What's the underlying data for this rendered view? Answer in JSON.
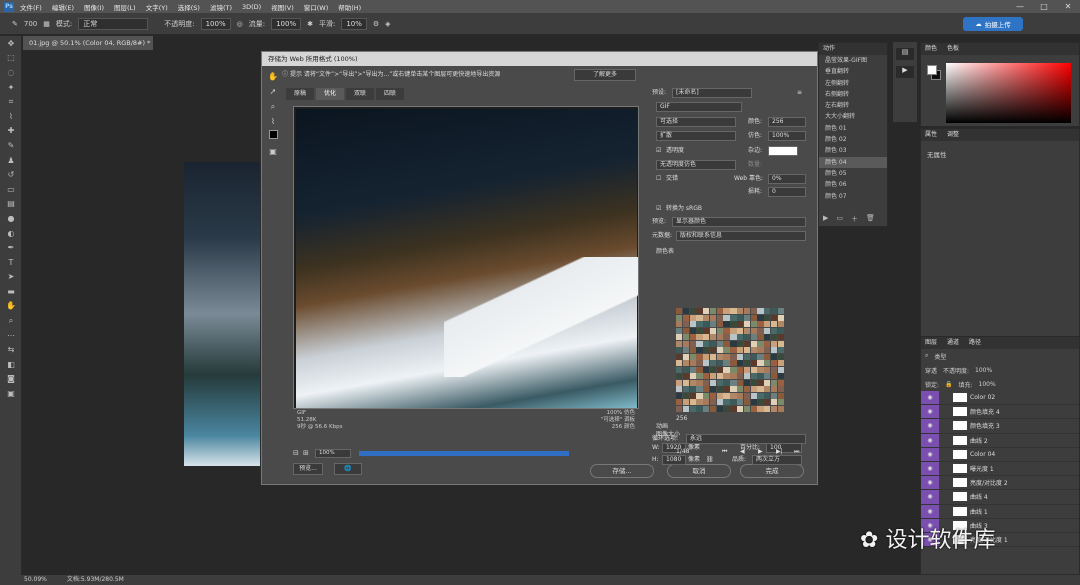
{
  "menubar": {
    "logo": "Ps",
    "items": [
      "文件(F)",
      "编辑(E)",
      "图像(I)",
      "图层(L)",
      "文字(Y)",
      "选择(S)",
      "滤镜(T)",
      "3D(D)",
      "视图(V)",
      "窗口(W)",
      "帮助(H)"
    ],
    "window_controls": [
      "—",
      "□",
      "✕"
    ]
  },
  "optbar": {
    "mode_label": "模式:",
    "mode_value": "正常",
    "opacity_label": "不透明度:",
    "opacity_value": "100%",
    "flow_label": "流量:",
    "flow_value": "100%",
    "smooth_label": "平滑:",
    "smooth_value": "10%",
    "brush_size": "700",
    "share_label": "拍摄上传"
  },
  "doc": {
    "tab": "01.jpg @ 50.1% (Color 04, RGB/8#) *",
    "status_zoom": "50.09%",
    "status_doc": "文档:5.93M/280.5M"
  },
  "dialog": {
    "title": "存储为 Web 所用格式 (100%)",
    "hint_prefix": "提示",
    "hint": "请将“文件”>“导出”>“导出为...”或右键单击某个图层可更快速地导出资源",
    "learn_more": "了解更多",
    "tabs": [
      "原稿",
      "优化",
      "双联",
      "四联"
    ],
    "preview_info_left": [
      "GIF",
      "51.28K",
      "9秒 @ 56.6 Kbps"
    ],
    "preview_info_right": [
      "100% 仿色",
      "\"可选择\" 调板",
      "256 颜色"
    ],
    "zoom": "100%",
    "preview_button": "预览...",
    "save": "存储...",
    "cancel": "取消",
    "done": "完成"
  },
  "settings": {
    "preset_label": "预设:",
    "preset_value": "[未命名]",
    "format": "GIF",
    "reduction": "可选择",
    "dither_algo": "扩散",
    "colors_label": "颜色:",
    "colors_value": "256",
    "dither_label": "仿色:",
    "dither_value": "100%",
    "transparency": "透明度",
    "matte_label": "杂边:",
    "no_transparency_dither": "无透明度仿色",
    "amount_label": "数量:",
    "interlaced": "交错",
    "web_snap_label": "Web 靠色:",
    "web_snap_value": "0%",
    "lossy_label": "损耗:",
    "lossy_value": "0",
    "convert_srgb": "转换为 sRGB",
    "preview_label": "预览:",
    "preview_value": "显示器颜色",
    "metadata_label": "元数据:",
    "metadata_value": "版权和联系信息",
    "color_table_label": "颜色表",
    "color_count": "256",
    "image_size_label": "图像大小",
    "w_label": "W:",
    "w_value": "1920",
    "h_label": "H:",
    "h_value": "1080",
    "px": "像素",
    "percent_label": "百分比:",
    "percent_value": "100",
    "quality_label": "品质:",
    "quality_value": "两次立方",
    "animation_label": "动画",
    "loop_label": "循环选项:",
    "loop_value": "永远",
    "frame": "1/48"
  },
  "history": {
    "header": "动作",
    "items": [
      "晶莹效果-GIF图",
      "垂直翻转",
      "左侧翻转",
      "右侧翻转",
      "左右翻转",
      "大大小翻转",
      "颜色 01",
      "颜色 02",
      "颜色 03",
      "颜色 04",
      "颜色 05",
      "颜色 06",
      "颜色 07"
    ],
    "selected": 9
  },
  "color_panel": {
    "tabs": [
      "颜色",
      "色板"
    ]
  },
  "adj_panel": {
    "tabs": [
      "属性",
      "调整"
    ],
    "text": "无属性"
  },
  "layers": {
    "tabs": [
      "图层",
      "通道",
      "路径"
    ],
    "kind": "类型",
    "blend": "穿透",
    "opacity_label": "不透明度:",
    "opacity_value": "100%",
    "lock_label": "锁定:",
    "fill_label": "填充:",
    "fill_value": "100%",
    "rows": [
      "Color 02",
      "颜色填充 4",
      "颜色填充 3",
      "曲线 2",
      "Color 04",
      "曝光度 1",
      "亮度/对比度 2",
      "曲线 4",
      "曲线 1",
      "曲线 3",
      "亮度/对比度 1"
    ]
  },
  "watermark": "设计软件库"
}
